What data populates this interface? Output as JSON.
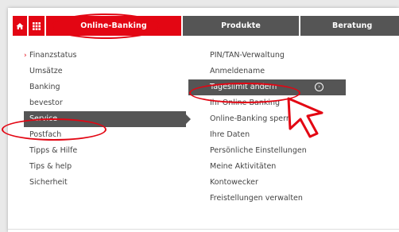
{
  "colors": {
    "brand_red": "#e30613",
    "nav_dark": "#555555",
    "text": "#444444"
  },
  "navbar": {
    "home_icon": "home-icon",
    "grid_icon": "grid-icon",
    "tabs": [
      {
        "label": "Online-Banking",
        "active": true
      },
      {
        "label": "Produkte",
        "active": false
      },
      {
        "label": "Beratung",
        "active": false
      }
    ]
  },
  "left_menu": {
    "items": [
      {
        "label": "Finanzstatus",
        "current": true
      },
      {
        "label": "Umsätze"
      },
      {
        "label": "Banking"
      },
      {
        "label": "bevestor"
      },
      {
        "label": "Service",
        "selected": true
      },
      {
        "label": "Postfach"
      },
      {
        "label": "Tipps & Hilfe"
      },
      {
        "label": "Tips & help"
      },
      {
        "label": "Sicherheit"
      }
    ]
  },
  "right_menu": {
    "items": [
      {
        "label": "PIN/TAN-Verwaltung"
      },
      {
        "label": "Anmeldename"
      },
      {
        "label": "Tageslimit ändern",
        "highlighted": true,
        "icon": "chevron-right-circle-icon"
      },
      {
        "label": "Ihr Online-Banking"
      },
      {
        "label": "Online-Banking sperren"
      },
      {
        "label": "Ihre Daten"
      },
      {
        "label": "Persönliche Einstellungen"
      },
      {
        "label": "Meine Aktivitäten"
      },
      {
        "label": "Kontowecker"
      },
      {
        "label": "Freistellungen verwalten"
      }
    ]
  },
  "annotations": {
    "pointer_icon": "hand-pointer-icon"
  }
}
